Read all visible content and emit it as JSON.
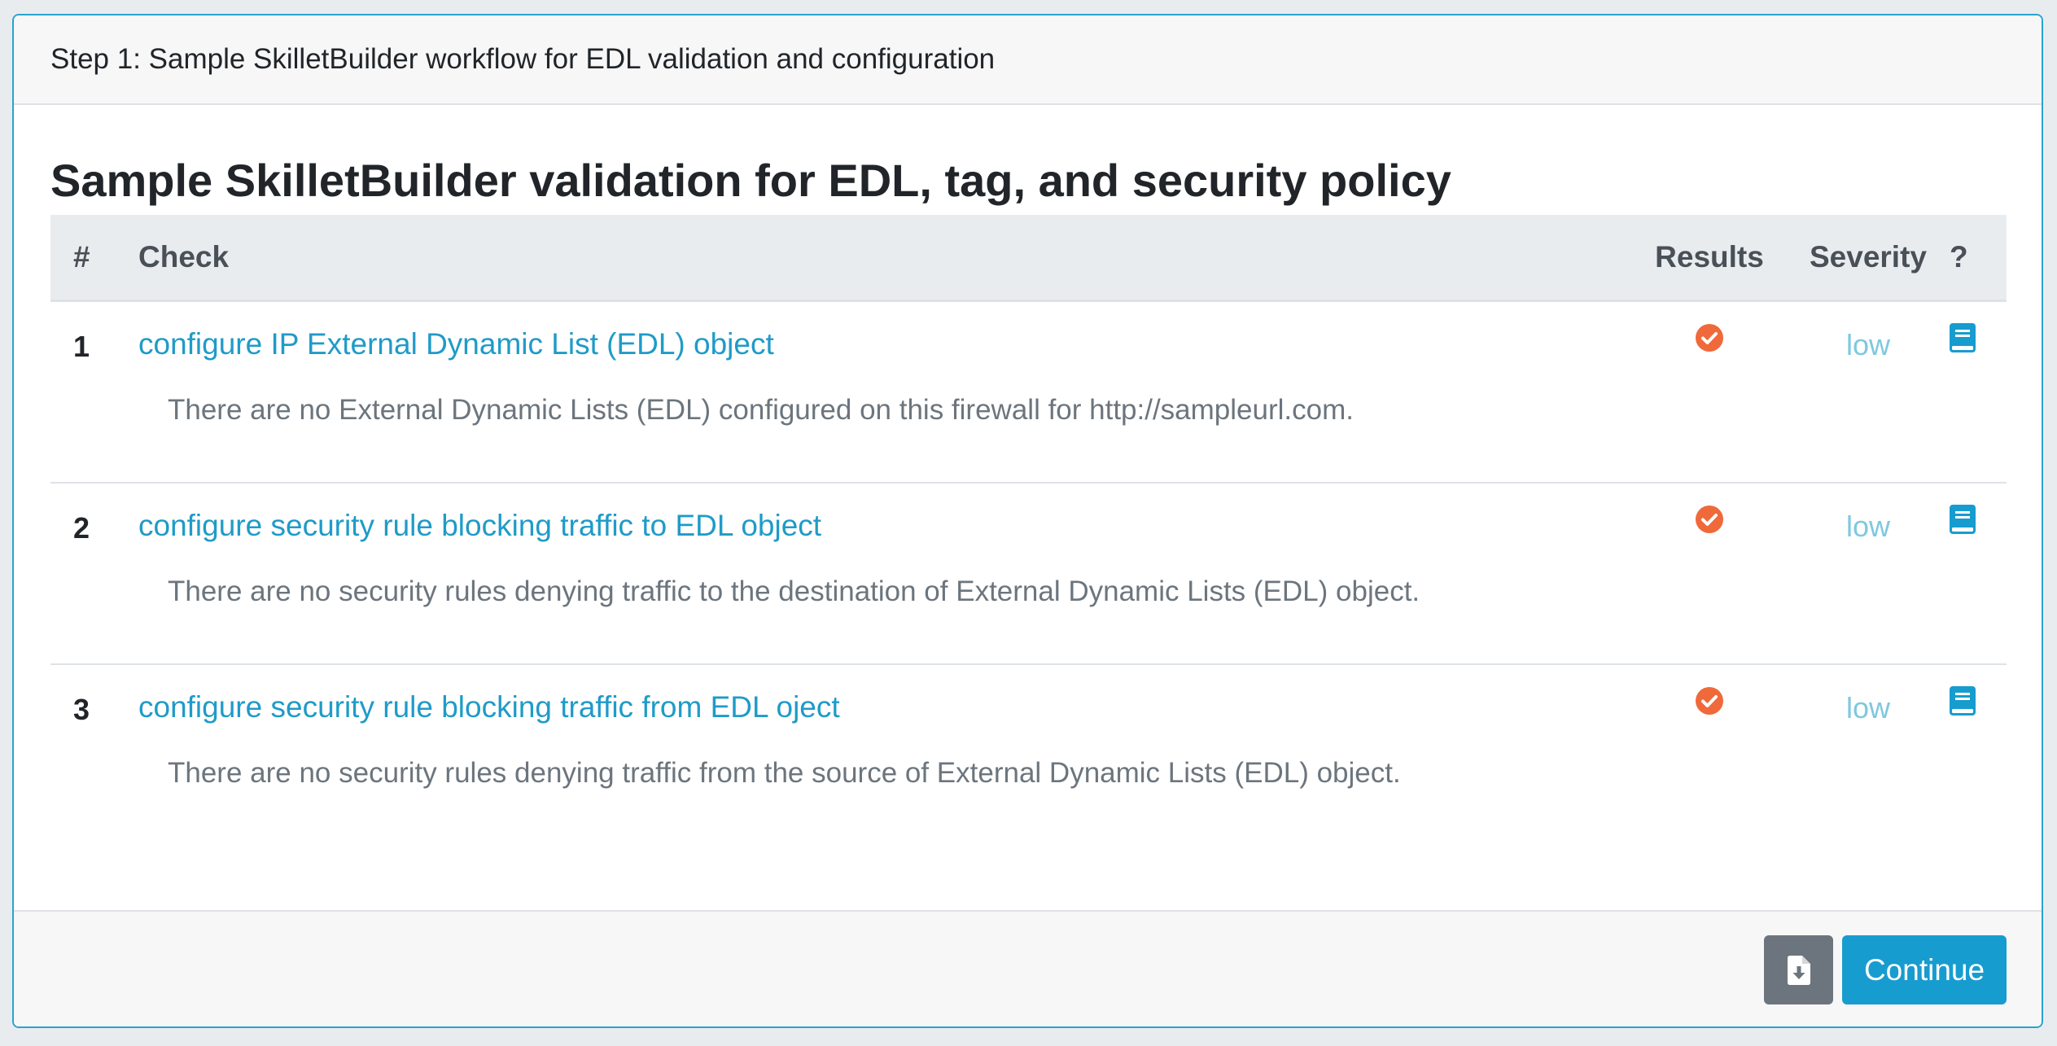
{
  "header": {
    "title": "Step 1: Sample SkilletBuilder workflow for EDL validation and configuration"
  },
  "main": {
    "title": "Sample SkilletBuilder validation for EDL, tag, and security policy",
    "columns": {
      "num": "#",
      "check": "Check",
      "results": "Results",
      "severity": "Severity",
      "help": "?"
    },
    "rows": [
      {
        "num": "1",
        "name": "configure IP External Dynamic List (EDL) object",
        "message": "There are no External Dynamic Lists (EDL) configured on this firewall for http://sampleurl.com.",
        "result_icon": "check-circle-icon",
        "severity": "low",
        "help_icon": "book-icon"
      },
      {
        "num": "2",
        "name": "configure security rule blocking traffic to EDL object",
        "message": "There are no security rules denying traffic to the destination of External Dynamic Lists (EDL) object.",
        "result_icon": "check-circle-icon",
        "severity": "low",
        "help_icon": "book-icon"
      },
      {
        "num": "3",
        "name": "configure security rule blocking traffic from EDL oject",
        "message": "There are no security rules denying traffic from the source of External Dynamic Lists (EDL) object.",
        "result_icon": "check-circle-icon",
        "severity": "low",
        "help_icon": "book-icon"
      }
    ]
  },
  "footer": {
    "download_icon": "file-download-icon",
    "continue_label": "Continue"
  },
  "colors": {
    "accent": "#179ccf",
    "link": "#1f9bc8",
    "result_ok": "#f0693a",
    "severity_low": "#7fc8df",
    "secondary_button": "#6c757d"
  }
}
